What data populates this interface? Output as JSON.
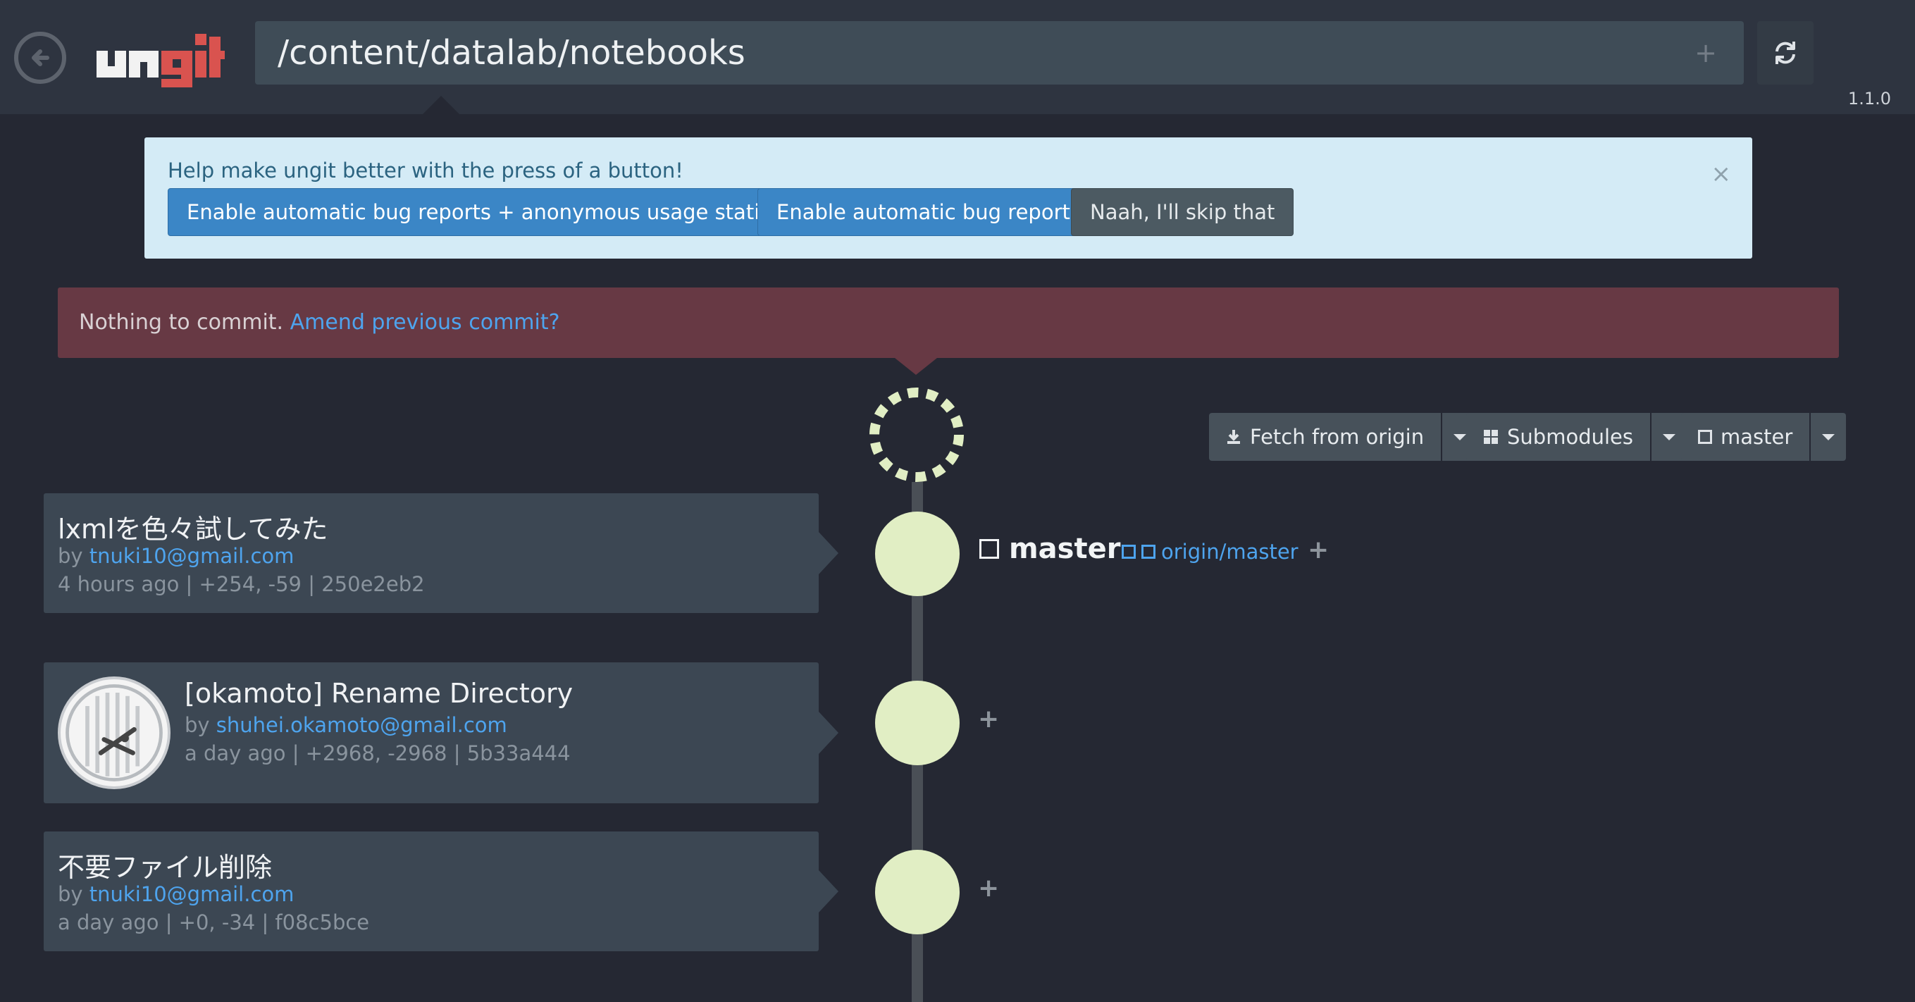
{
  "header": {
    "path": "/content/datalab/notebooks",
    "version": "1.1.0",
    "logo_text": "ungit",
    "add_icon": "plus-icon",
    "refresh_icon": "refresh-icon",
    "back_icon": "back-arrow-icon"
  },
  "help_banner": {
    "text": "Help make ungit better with the press of a button!",
    "close": "×",
    "buttons": [
      "Enable automatic bug reports + anonymous usage statistics",
      "Enable automatic bug reports",
      "Naah, I'll skip that"
    ]
  },
  "commit_bar": {
    "text": "Nothing to commit. ",
    "link": "Amend previous commit?"
  },
  "toolbar": {
    "fetch_label": "Fetch from origin",
    "submodules_label": "Submodules",
    "branch_label": "master"
  },
  "refs": {
    "local": "master",
    "remote": "origin/master"
  },
  "commits": [
    {
      "title": "lxmlを色々試してみた",
      "by_prefix": "by ",
      "author": "tnuki10@gmail.com",
      "meta": "4 hours ago | +254, -59 | 250e2eb2"
    },
    {
      "title": "[okamoto] Rename Directory",
      "by_prefix": "by ",
      "author": "shuhei.okamoto@gmail.com",
      "meta": "a day ago | +2968, -2968 | 5b33a444"
    },
    {
      "title": "不要ファイル削除",
      "by_prefix": "by ",
      "author": "tnuki10@gmail.com",
      "meta": "a day ago | +0, -34 | f08c5bce"
    }
  ],
  "colors": {
    "background": "#252833",
    "header": "#2e3440",
    "accent": "#3b86c6",
    "link": "#4ea4ee",
    "warning_bar": "#673944",
    "node": "#e1eec4",
    "logo_red": "#d9534f"
  }
}
